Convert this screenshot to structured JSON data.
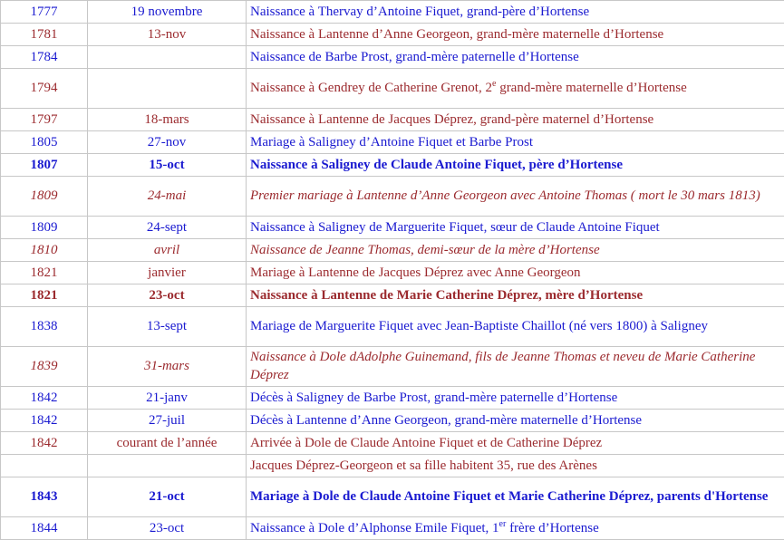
{
  "rows": [
    {
      "year": "1777",
      "date": "19 novembre",
      "event": "Naissance à Thervay d’Antoine Fiquet, grand-père d’Hortense",
      "color": "blue"
    },
    {
      "year": "1781",
      "date": "13-nov",
      "event": "Naissance à Lantenne d’Anne Georgeon, grand-mère maternelle d’Hortense",
      "color": "red"
    },
    {
      "year": "1784",
      "date": "",
      "event": "Naissance de Barbe Prost, grand-mère paternelle d’Hortense",
      "color": "blue"
    },
    {
      "year": "1794",
      "date": "",
      "event_pre": "Naissance à Gendrey de Catherine Grenot, 2",
      "event_sup": "e",
      "event_post": " grand-mère maternelle d’Hortense",
      "color": "red"
    },
    {
      "year": "1797",
      "date": "18-mars",
      "event": "Naissance à Lantenne de Jacques Déprez, grand-père maternel d’Hortense",
      "color": "red"
    },
    {
      "year": "1805",
      "date": "27-nov",
      "event": "Mariage à Saligney d’Antoine Fiquet et Barbe Prost",
      "color": "blue"
    },
    {
      "year": "1807",
      "date": "15-oct",
      "event": "Naissance à Saligney de Claude Antoine Fiquet, père d’Hortense",
      "color": "blue",
      "style": "bold"
    },
    {
      "year": "1809",
      "date": "24-mai",
      "event": "Premier mariage à Lantenne d’Anne Georgeon avec Antoine Thomas ( mort le 30 mars 1813)",
      "color": "red",
      "style": "italic"
    },
    {
      "year": "1809",
      "date": "24-sept",
      "event": "Naissance à Saligney de Marguerite Fiquet, sœur de Claude Antoine Fiquet",
      "color": "blue"
    },
    {
      "year": "1810",
      "date": "avril",
      "event": "Naissance de Jeanne Thomas, demi-sœur de la mère d’Hortense",
      "color": "red",
      "style": "italic"
    },
    {
      "year": "1821",
      "date": "janvier",
      "event": "Mariage à Lantenne de Jacques Déprez avec Anne Georgeon",
      "color": "red"
    },
    {
      "year": "1821",
      "date": "23-oct",
      "event": "Naissance à Lantenne de Marie Catherine Déprez, mère d’Hortense",
      "color": "red",
      "style": "bold"
    },
    {
      "year": "1838",
      "date": "13-sept",
      "event": "Mariage de Marguerite Fiquet avec Jean-Baptiste Chaillot (né vers 1800) à Saligney",
      "color": "blue"
    },
    {
      "year": "1839",
      "date": "31-mars",
      "event": "Naissance à Dole dAdolphe Guinemand, fils de Jeanne Thomas et neveu de Marie Catherine Déprez",
      "color": "red",
      "style": "italic"
    },
    {
      "year": "1842",
      "date": "21-janv",
      "event": "Décès à Saligney de Barbe Prost, grand-mère paternelle d’Hortense",
      "color": "blue"
    },
    {
      "year": "1842",
      "date": "27-juil",
      "event": "Décès à Lantenne d’Anne Georgeon, grand-mère maternelle d’Hortense",
      "color": "blue"
    },
    {
      "year": "1842",
      "date": "courant de l’année",
      "event": "Arrivée à Dole de Claude Antoine Fiquet et de Catherine Déprez",
      "color": "red"
    },
    {
      "year": "",
      "date": "",
      "event": "Jacques Déprez-Georgeon et sa fille habitent 35, rue des Arènes",
      "color": "red"
    },
    {
      "year": "1843",
      "date": "21-oct",
      "event": "Mariage à Dole de Claude Antoine Fiquet et Marie Catherine Déprez, parents d'Hortense",
      "color": "blue",
      "style": "bold"
    },
    {
      "year": "1844",
      "date": "23-oct",
      "event_pre": "Naissance à Dole d’Alphonse Emile Fiquet, 1",
      "event_sup": "er",
      "event_post": " frère d’Hortense",
      "color": "blue"
    }
  ],
  "colors": {
    "blue": "#1a1ad0",
    "red": "#9b2a2e",
    "border": "#c7c7c7"
  }
}
